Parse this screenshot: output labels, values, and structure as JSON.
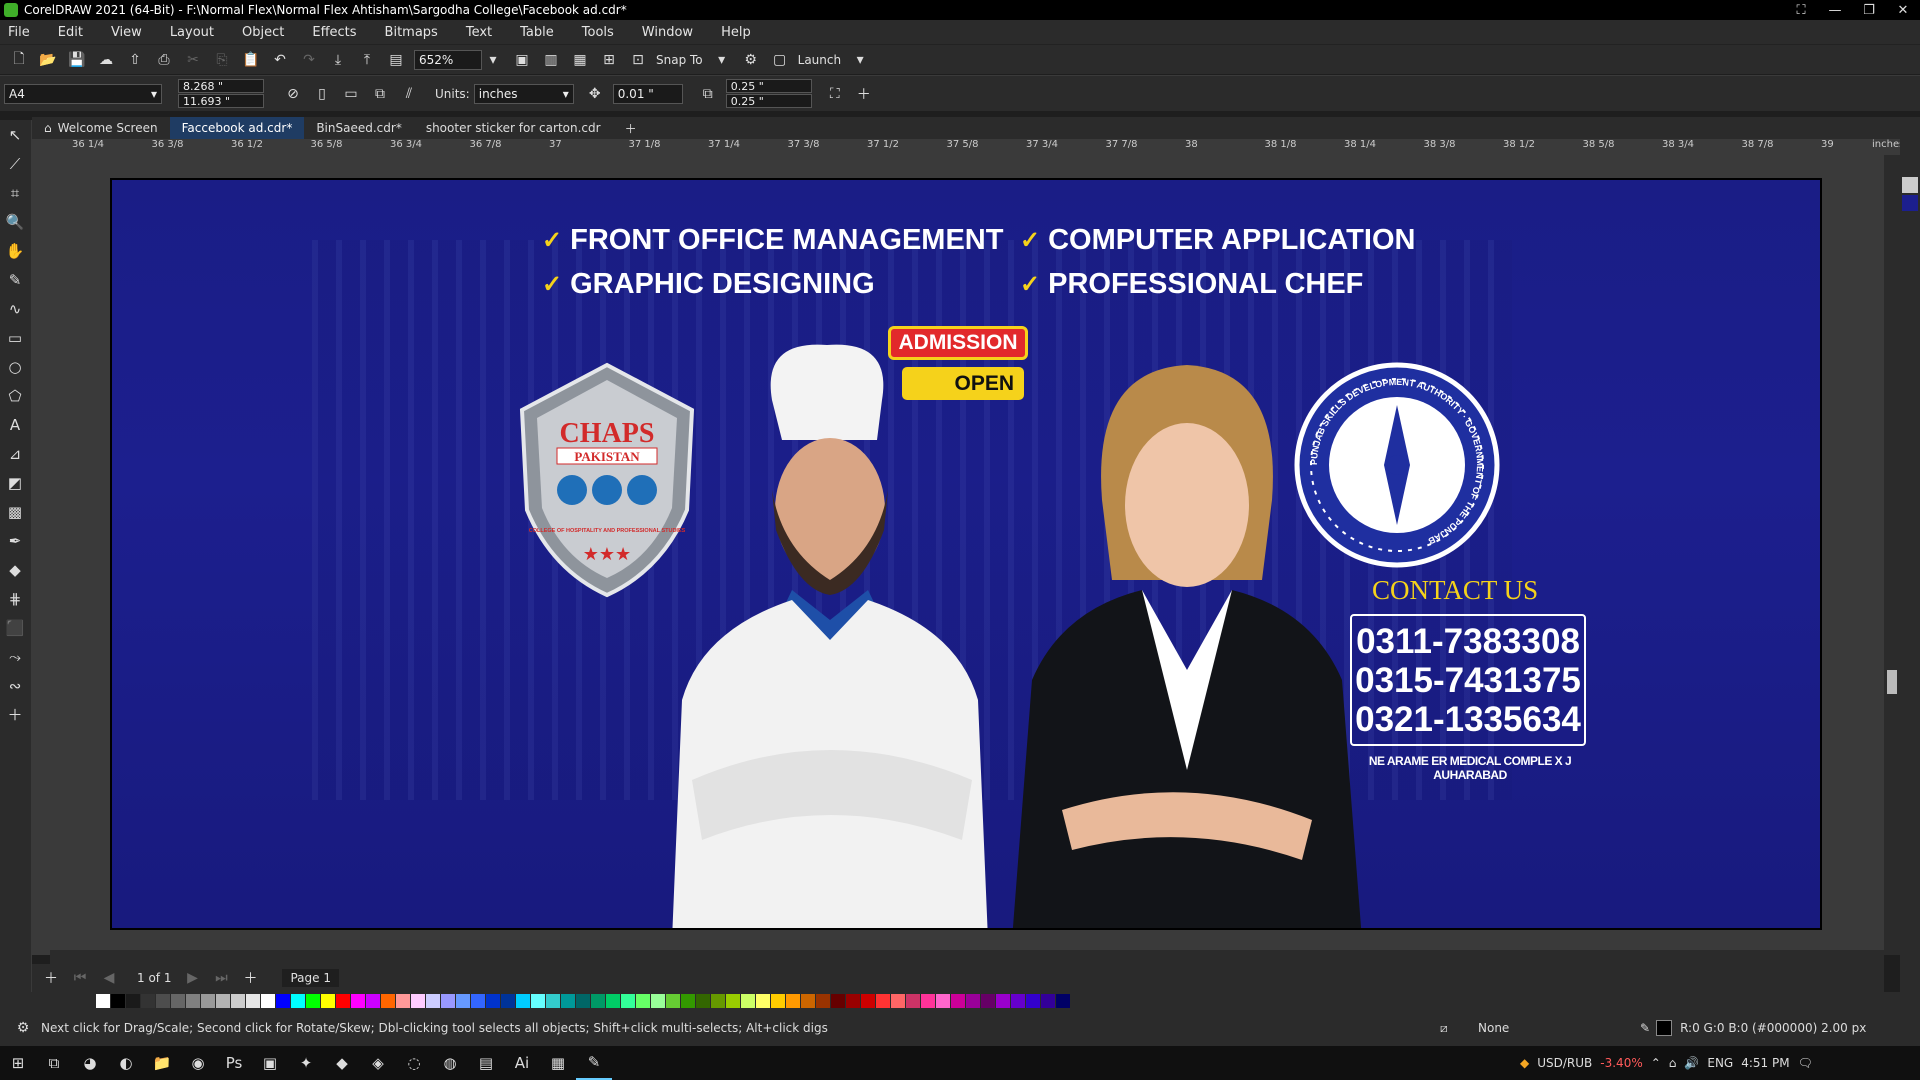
{
  "window": {
    "title": "CorelDRAW 2021 (64-Bit) - F:\\Normal Flex\\Normal Flex Ahtisham\\Sargodha College\\Facebook ad.cdr*"
  },
  "menu": [
    "File",
    "Edit",
    "View",
    "Layout",
    "Object",
    "Effects",
    "Bitmaps",
    "Text",
    "Table",
    "Tools",
    "Window",
    "Help"
  ],
  "toolbar": {
    "zoom": "652%",
    "snap_to": "Snap To",
    "launch": "Launch"
  },
  "propertybar": {
    "page_size": "A4",
    "width": "8.268 \"",
    "height": "11.693 \"",
    "units_label": "Units:",
    "units": "inches",
    "nudge": "0.01 \"",
    "dup_x": "0.25 \"",
    "dup_y": "0.25 \""
  },
  "tabs": [
    "Welcome Screen",
    "Faccebook ad.cdr*",
    "BinSaeed.cdr*",
    "shooter sticker for carton.cdr"
  ],
  "ruler": {
    "ticks": [
      "36 1/4",
      "36 3/8",
      "36 1/2",
      "36 5/8",
      "36 3/4",
      "36 7/8",
      "37",
      "37 1/8",
      "37 1/4",
      "37 3/8",
      "37 1/2",
      "37 5/8",
      "37 3/4",
      "37 7/8",
      "38",
      "38 1/8",
      "38 1/4",
      "38 3/8",
      "38 1/2",
      "38 5/8",
      "38 3/4",
      "38 7/8",
      "39"
    ],
    "unit": "inches"
  },
  "ad": {
    "bullets": [
      "FRONT OFFICE MANAGEMENT",
      "GRAPHIC DESIGNING",
      "COMPUTER APPLICATION",
      "PROFESSIONAL CHEF"
    ],
    "check": "✓",
    "shield": {
      "name": "CHAPS",
      "country": "PAKISTAN",
      "subtitle": "COLLEGE OF HOSPITALITY AND PROFESSIONAL STUDIES"
    },
    "admission": "ADMISSION",
    "open": "OPEN",
    "seal_text": "PUNJAB SKILLS DEVELOPMENT AUTHORITY · GOVERNMENT OF THE PUNJAB",
    "contact_title": "CONTACT US",
    "phones": [
      "0311-7383308",
      "0315-7431375",
      "0321-1335634"
    ],
    "address": "NE ARAME ER MEDICAL COMPLE X J AUHARABAD"
  },
  "pagebar": {
    "page_count": "1 of 1",
    "page_tab": "Page 1"
  },
  "status": {
    "hint": "Next click for Drag/Scale; Second click for Rotate/Skew; Dbl-clicking tool selects all objects; Shift+click multi-selects; Alt+click digs",
    "fill": "None",
    "outline": "R:0 G:0 B:0 (#000000)  2.00 px"
  },
  "taskbar": {
    "ticker": "USD/RUB",
    "change": "-3.40%",
    "lang": "ENG",
    "time": "4:51 PM"
  },
  "palette": [
    "#ffffff",
    "#000000",
    "#1a1a1a",
    "#333333",
    "#4d4d4d",
    "#666666",
    "#808080",
    "#999999",
    "#b3b3b3",
    "#cccccc",
    "#e6e6e6",
    "#ffffff",
    "#0000ff",
    "#00ffff",
    "#00ff00",
    "#ffff00",
    "#ff0000",
    "#ff00ff",
    "#cc00ff",
    "#ff6600",
    "#ff9999",
    "#ffccff",
    "#ccccff",
    "#9999ff",
    "#6699ff",
    "#3366ff",
    "#0033cc",
    "#003399",
    "#00ccff",
    "#66ffff",
    "#33cccc",
    "#009999",
    "#006666",
    "#009966",
    "#00cc66",
    "#33ff99",
    "#66ff66",
    "#99ff99",
    "#66cc33",
    "#339900",
    "#336600",
    "#669900",
    "#99cc00",
    "#ccff66",
    "#ffff66",
    "#ffcc00",
    "#ff9900",
    "#cc6600",
    "#993300",
    "#660000",
    "#990000",
    "#cc0000",
    "#ff3333",
    "#ff6666",
    "#cc3366",
    "#ff3399",
    "#ff66cc",
    "#cc0099",
    "#990099",
    "#660066",
    "#9900cc",
    "#6600cc",
    "#3300cc",
    "#330099",
    "#000066"
  ]
}
